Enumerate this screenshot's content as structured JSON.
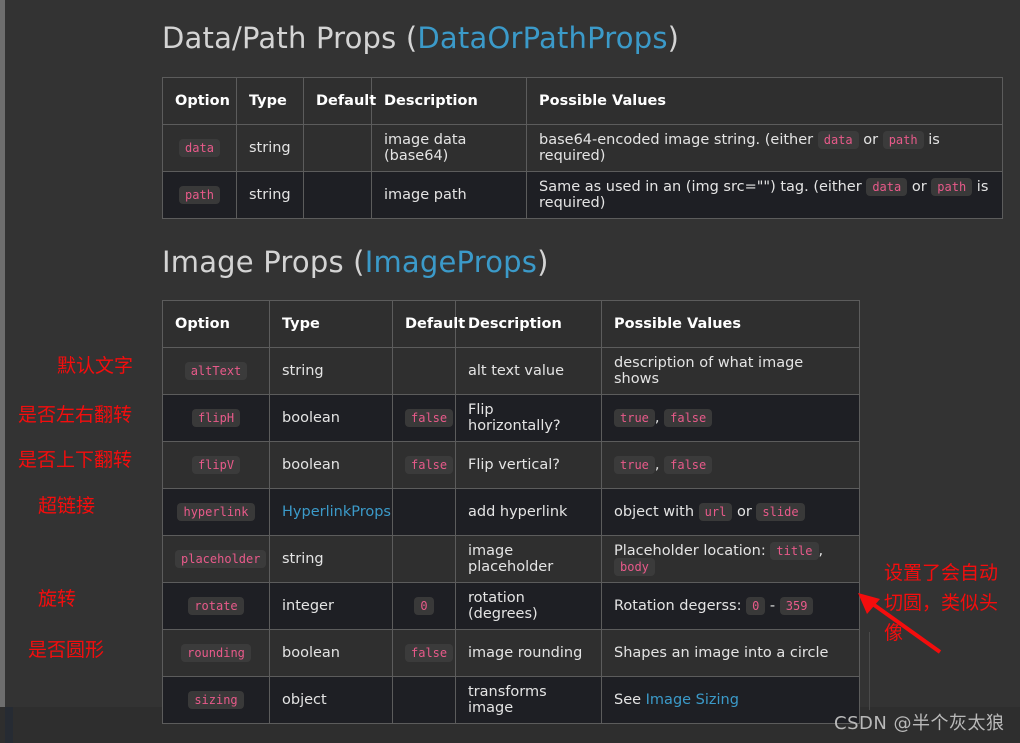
{
  "sections": [
    {
      "title_plain": "Data/Path Props (",
      "title_link": "DataOrPathProps",
      "title_close": ")"
    },
    {
      "title_plain": "Image Props (",
      "title_link": "ImageProps",
      "title_close": ")"
    }
  ],
  "table_datapath": {
    "headers": [
      "Option",
      "Type",
      "Default",
      "Description",
      "Possible Values"
    ],
    "rows": [
      {
        "option": "data",
        "type": "string",
        "default": "",
        "description": "image data (base64)",
        "pv_pre": "base64-encoded image string. (either ",
        "pv_tok1": "data",
        "pv_mid": " or ",
        "pv_tok2": "path",
        "pv_post": " is required)"
      },
      {
        "option": "path",
        "type": "string",
        "default": "",
        "description": "image path",
        "pv_pre": "Same as used in an (img src=\"\") tag. (either ",
        "pv_tok1": "data",
        "pv_mid": " or ",
        "pv_tok2": "path",
        "pv_post": " is required)"
      }
    ]
  },
  "table_imageprops": {
    "headers": [
      "Option",
      "Type",
      "Default",
      "Description",
      "Possible Values"
    ],
    "rows": [
      {
        "option": "altText",
        "type": "string",
        "type_is_link": false,
        "default": "",
        "description": "alt text value",
        "pv_pre": "description of what image shows",
        "pv_tok1": "",
        "pv_mid": "",
        "pv_tok2": "",
        "pv_post": ""
      },
      {
        "option": "flipH",
        "type": "boolean",
        "type_is_link": false,
        "default": "false",
        "description": "Flip horizontally?",
        "pv_pre": "",
        "pv_tok1": "true",
        "pv_mid": ", ",
        "pv_tok2": "false",
        "pv_post": ""
      },
      {
        "option": "flipV",
        "type": "boolean",
        "type_is_link": false,
        "default": "false",
        "description": "Flip vertical?",
        "pv_pre": "",
        "pv_tok1": "true",
        "pv_mid": ", ",
        "pv_tok2": "false",
        "pv_post": ""
      },
      {
        "option": "hyperlink",
        "type": "HyperlinkProps",
        "type_is_link": true,
        "default": "",
        "description": "add hyperlink",
        "pv_pre": "object with ",
        "pv_tok1": "url",
        "pv_mid": " or ",
        "pv_tok2": "slide",
        "pv_post": ""
      },
      {
        "option": "placeholder",
        "type": "string",
        "type_is_link": false,
        "default": "",
        "description": "image placeholder",
        "pv_pre": "Placeholder location: ",
        "pv_tok1": "title",
        "pv_mid": ", ",
        "pv_tok2": "body",
        "pv_post": ""
      },
      {
        "option": "rotate",
        "type": "integer",
        "type_is_link": false,
        "default": "0",
        "description": "rotation (degrees)",
        "pv_pre": "Rotation degerss: ",
        "pv_tok1": "0",
        "pv_mid": " - ",
        "pv_tok2": "359",
        "pv_post": ""
      },
      {
        "option": "rounding",
        "type": "boolean",
        "type_is_link": false,
        "default": "false",
        "description": "image rounding",
        "pv_pre": "Shapes an image into a circle",
        "pv_tok1": "",
        "pv_mid": "",
        "pv_tok2": "",
        "pv_post": ""
      },
      {
        "option": "sizing",
        "type": "object",
        "type_is_link": false,
        "default": "",
        "description": "transforms image",
        "pv_pre": "See ",
        "pv_link": "Image Sizing",
        "pv_tok1": "",
        "pv_mid": "",
        "pv_tok2": "",
        "pv_post": ""
      }
    ]
  },
  "annotations": {
    "alt_text": "默认文字",
    "flip_h": "是否左右翻转",
    "flip_v": "是否上下翻转",
    "hyperlink": "超链接",
    "rotate": "旋转",
    "rounding": "是否圆形",
    "rounding_note": "设置了会自动切圆，类似头像"
  },
  "watermark": "CSDN @半个灰太狼",
  "colors": {
    "background": "#333333",
    "table_row_odd": "#2f2f2f",
    "table_row_even": "#1e1f24",
    "border": "#5c5c5c",
    "text": "#e4e4e4",
    "link": "#3b9ac9",
    "code_token": "#e85a8a",
    "annotation_red": "#f40d0d",
    "watermark": "#b9b9b9"
  }
}
